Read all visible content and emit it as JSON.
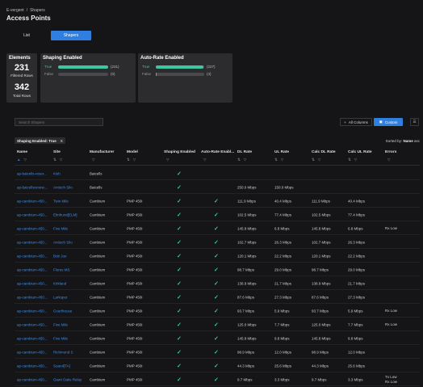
{
  "breadcrumb": {
    "root": "E-vergent",
    "sep": "/",
    "current": "Shapers"
  },
  "page_title": "Access Points",
  "tabs": {
    "list": "List",
    "shapers": "Shapers"
  },
  "cards": {
    "elements": {
      "title": "Elements",
      "filtered_count": "231",
      "filtered_label": "Filtered Rows",
      "total_count": "342",
      "total_label": "Total Rows"
    },
    "shaping": {
      "title": "Shaping Enabled",
      "true_label": "True",
      "true_count": "(231)",
      "false_label": "False",
      "false_count": "(0)",
      "true_fraction": 1.0,
      "false_fraction": 0.0
    },
    "autorate": {
      "title": "Auto-Rate Enabled",
      "true_label": "True",
      "true_count": "(227)",
      "false_label": "False",
      "false_count": "(4)",
      "true_fraction": 0.98,
      "false_fraction": 0.02
    }
  },
  "toolbar": {
    "search_placeholder": "Search Shapers",
    "all_columns": "All Columns",
    "custom": "Custom",
    "menu_icon": "☰"
  },
  "filter_chip": {
    "label": "Shaping Enabled: True",
    "close": "X"
  },
  "sort": {
    "prefix": "Sorted by:",
    "field": "Name",
    "dir": "asc"
  },
  "columns": [
    "Name",
    "Site",
    "Manufacturer",
    "Model",
    "Shaping Enabled",
    "Auto-Rate Enabl...",
    "DL Rate",
    "UL Rate",
    "Calc DL Rate",
    "Calc UL Rate",
    "Errors"
  ],
  "column_icons": {
    "sort": "⇅",
    "filter": "▽",
    "sort_asc": "▲"
  },
  "check": "✓",
  "rows": [
    {
      "name": "ap-baicells-reser...",
      "site": "Kish",
      "mfr": "Baicells",
      "model": "",
      "shaping": true,
      "autorate": false,
      "dl": "",
      "ul": "",
      "cdl": "",
      "cul": "",
      "err": ""
    },
    {
      "name": "ap-baicellsrenew...",
      "site": "Antioch Silo",
      "mfr": "Baicells",
      "model": "",
      "shaping": true,
      "autorate": false,
      "dl": "250.0 Mbps",
      "ul": "150.0 Mbps",
      "cdl": "",
      "cul": "",
      "err": ""
    },
    {
      "name": "ap-cambium-450...",
      "site": "Twin Mile",
      "mfr": "Cambium",
      "model": "PMP 450i",
      "shaping": true,
      "autorate": true,
      "dl": "111.9 Mbps",
      "ul": "40.4 Mbps",
      "cdl": "111.9 Mbps",
      "cul": "40.4 Mbps",
      "err": ""
    },
    {
      "name": "ap-cambium-450...",
      "site": "Elmhurst[ELM]",
      "mfr": "Cambium",
      "model": "PMP 450i",
      "shaping": true,
      "autorate": true,
      "dl": "102.5 Mbps",
      "ul": "77.4 Mbps",
      "cdl": "102.5 Mbps",
      "cul": "77.4 Mbps",
      "err": ""
    },
    {
      "name": "ap-cambium-450...",
      "site": "Five Mile",
      "mfr": "Cambium",
      "model": "PMP 450i",
      "shaping": true,
      "autorate": true,
      "dl": "145.8 Mbps",
      "ul": "6.8 Mbps",
      "cdl": "145.8 Mbps",
      "cul": "6.8 Mbps",
      "err": "Rx Low"
    },
    {
      "name": "ap-cambium-450...",
      "site": "Antioch Silo",
      "mfr": "Cambium",
      "model": "PMP 450i",
      "shaping": true,
      "autorate": true,
      "dl": "102.7 Mbps",
      "ul": "26.3 Mbps",
      "cdl": "102.7 Mbps",
      "cul": "26.3 Mbps",
      "err": ""
    },
    {
      "name": "ap-cambium-450...",
      "site": "Bob Joe",
      "mfr": "Cambium",
      "model": "PMP 450i",
      "shaping": true,
      "autorate": true,
      "dl": "120.1 Mbps",
      "ul": "22.2 Mbps",
      "cdl": "120.1 Mbps",
      "cul": "22.2 Mbps",
      "err": ""
    },
    {
      "name": "ap-cambium-450...",
      "site": "Flores MS",
      "mfr": "Cambium",
      "model": "PMP 450i",
      "shaping": true,
      "autorate": true,
      "dl": "98.7 Mbps",
      "ul": "29.0 Mbps",
      "cdl": "98.7 Mbps",
      "cul": "29.0 Mbps",
      "err": ""
    },
    {
      "name": "ap-cambium-450...",
      "site": "Kirkland",
      "mfr": "Cambium",
      "model": "PMP 450i",
      "shaping": true,
      "autorate": true,
      "dl": "138.9 Mbps",
      "ul": "21.7 Mbps",
      "cdl": "138.9 Mbps",
      "cul": "21.7 Mbps",
      "err": ""
    },
    {
      "name": "ap-cambium-450...",
      "site": "Larkspur",
      "mfr": "Cambium",
      "model": "PMP 450i",
      "shaping": true,
      "autorate": true,
      "dl": "87.6 Mbps",
      "ul": "27.3 Mbps",
      "cdl": "87.6 Mbps",
      "cul": "27.3 Mbps",
      "err": ""
    },
    {
      "name": "ap-cambium-450...",
      "site": "Courthouse",
      "mfr": "Cambium",
      "model": "PMP 450i",
      "shaping": true,
      "autorate": true,
      "dl": "93.7 Mbps",
      "ul": "5.9 Mbps",
      "cdl": "93.7 Mbps",
      "cul": "5.9 Mbps",
      "err": "Rx Low"
    },
    {
      "name": "ap-cambium-450...",
      "site": "Five Mile",
      "mfr": "Cambium",
      "model": "PMP 450i",
      "shaping": true,
      "autorate": true,
      "dl": "125.0 Mbps",
      "ul": "7.7 Mbps",
      "cdl": "125.0 Mbps",
      "cul": "7.7 Mbps",
      "err": "Rx Low"
    },
    {
      "name": "ap-cambium-450...",
      "site": "Five Mile",
      "mfr": "Cambium",
      "model": "PMP 450i",
      "shaping": true,
      "autorate": true,
      "dl": "145.8 Mbps",
      "ul": "9.8 Mbps",
      "cdl": "145.8 Mbps",
      "cul": "9.8 Mbps",
      "err": ""
    },
    {
      "name": "ap-cambium-450...",
      "site": "Richmond S",
      "mfr": "Cambium",
      "model": "PMP 450i",
      "shaping": true,
      "autorate": true,
      "dl": "98.9 Mbps",
      "ul": "12.0 Mbps",
      "cdl": "98.9 Mbps",
      "cul": "12.0 Mbps",
      "err": ""
    },
    {
      "name": "ap-cambium-450...",
      "site": "Soarol[TA]",
      "mfr": "Cambium",
      "model": "PMP 450i",
      "shaping": true,
      "autorate": true,
      "dl": "44.3 Mbps",
      "ul": "25.6 Mbps",
      "cdl": "44.3 Mbps",
      "cul": "25.6 Mbps",
      "err": ""
    },
    {
      "name": "ap-cambium-450...",
      "site": "Giant Oaks Relay",
      "mfr": "Cambium",
      "model": "PMP 450i",
      "shaping": true,
      "autorate": true,
      "dl": "9.7 Mbps",
      "ul": "3.3 Mbps",
      "cdl": "9.7 Mbps",
      "cul": "3.3 Mbps",
      "err": "Tx Low\nRx Low"
    }
  ]
}
